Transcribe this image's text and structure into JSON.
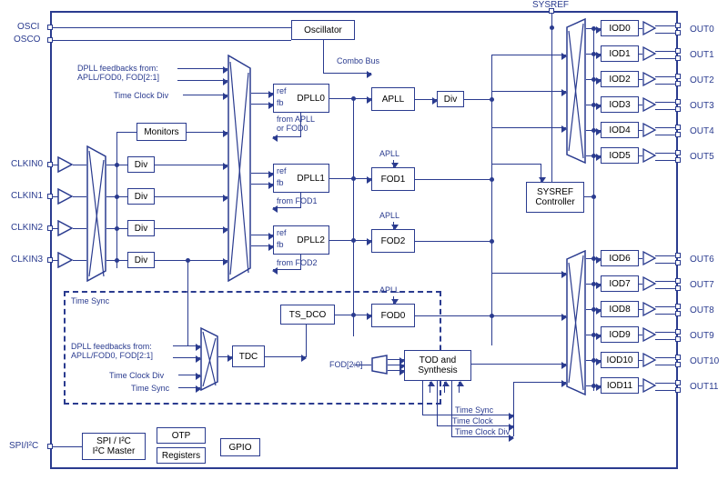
{
  "ports": {
    "left": {
      "osci": "OSCI",
      "osco": "OSCO",
      "clkin0": "CLKIN0",
      "clkin1": "CLKIN1",
      "clkin2": "CLKIN2",
      "clkin3": "CLKIN3",
      "spi_i2c": "SPI/I²C"
    },
    "top": {
      "sysref": "SYSREF"
    },
    "right": {
      "out0": "OUT0",
      "out1": "OUT1",
      "out2": "OUT2",
      "out3": "OUT3",
      "out4": "OUT4",
      "out5": "OUT5",
      "out6": "OUT6",
      "out7": "OUT7",
      "out8": "OUT8",
      "out9": "OUT9",
      "out10": "OUT10",
      "out11": "OUT11"
    }
  },
  "blocks": {
    "oscillator": "Oscillator",
    "monitors": "Monitors",
    "div": "Div",
    "dpll0": "DPLL0",
    "dpll1": "DPLL1",
    "dpll2": "DPLL2",
    "apll": "APLL",
    "fod0": "FOD0",
    "fod1": "FOD1",
    "fod2": "FOD2",
    "ts_dco": "TS_DCO",
    "tdc": "TDC",
    "tod": "TOD and\nSynthesis",
    "sysref_ctrl": "SYSREF\nController",
    "iod0": "IOD0",
    "iod1": "IOD1",
    "iod2": "IOD2",
    "iod3": "IOD3",
    "iod4": "IOD4",
    "iod5": "IOD5",
    "iod6": "IOD6",
    "iod7": "IOD7",
    "iod8": "IOD8",
    "iod9": "IOD9",
    "iod10": "IOD10",
    "iod11": "IOD11",
    "spi_master": "SPI / I²C\nI²C Master",
    "otp": "OTP",
    "registers": "Registers",
    "gpio": "GPIO"
  },
  "labels": {
    "combo_bus": "Combo Bus",
    "dpll_feedbacks": "DPLL feedbacks from:\nAPLL/FOD0, FOD[2:1]",
    "time_clock_div": "Time Clock Div",
    "time_sync": "Time Sync",
    "time_clock": "Time Clock",
    "from_apll_or_fod0": "from APLL\nor FOD0",
    "from_fod1": "from FOD1",
    "from_fod2": "from FOD2",
    "ref": "ref",
    "fb": "fb",
    "apll_small": "APLL",
    "fod_bus": "FOD[2:0]"
  }
}
